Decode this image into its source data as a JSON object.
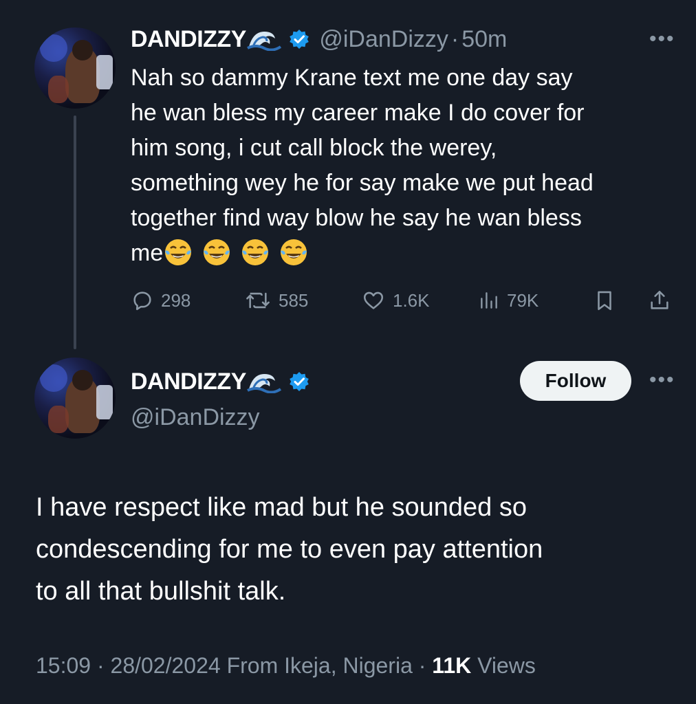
{
  "reply_tweet": {
    "display_name": "DANDIZZY",
    "handle": "@iDanDizzy",
    "separator": "·",
    "time": "50m",
    "text_lines": [
      "Nah so dammy  Krane  text me one day say",
      "he wan bless my career make I do cover for",
      "him song, i cut call block the werey,",
      "something wey he for say make we put head",
      "together find way blow he say he wan bless",
      "me"
    ],
    "stats": {
      "replies": "298",
      "reposts": "585",
      "likes": "1.6K",
      "views": "79K"
    }
  },
  "main_tweet": {
    "display_name": "DANDIZZY",
    "handle": "@iDanDizzy",
    "follow_label": "Follow",
    "text_lines": [
      "I have respect like mad but he sounded so",
      "condescending for me to even pay attention",
      "to all that bullshit talk."
    ],
    "meta": {
      "time": "15:09",
      "sep1": "·",
      "date": "28/02/2024",
      "location": "From Ikeja, Nigeria",
      "sep2": "·",
      "views_count": "11K",
      "views_label": "Views"
    }
  },
  "icons": {
    "more": "more-dots-icon",
    "wave": "water-wave-icon",
    "verified": "verified-badge-icon",
    "emoji": "tears-of-joy-emoji"
  },
  "colors": {
    "background": "#161c26",
    "muted": "#8b98a5",
    "verified": "#1d9bf0",
    "follow_bg": "#eff3f4"
  }
}
